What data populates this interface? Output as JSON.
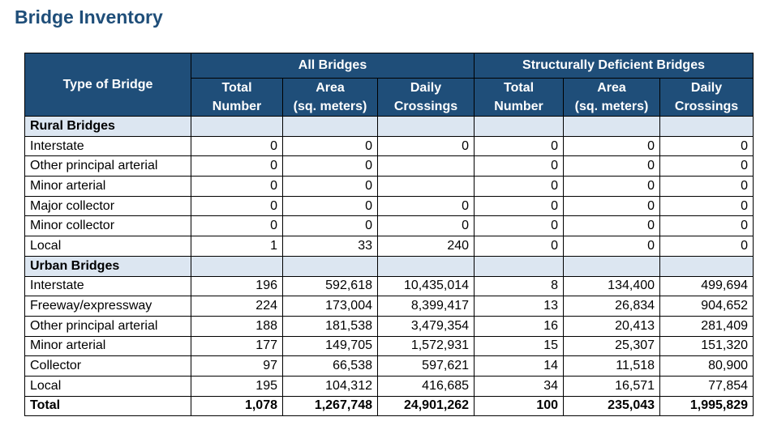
{
  "title": "Bridge Inventory",
  "table": {
    "type_header": "Type of Bridge",
    "group_headers": [
      "All Bridges",
      "Structurally Deficient Bridges"
    ],
    "col_headers": [
      [
        "Total",
        "Number"
      ],
      [
        "Area",
        "(sq. meters)"
      ],
      [
        "Daily",
        "Crossings"
      ],
      [
        "Total",
        "Number"
      ],
      [
        "Area",
        "(sq. meters)"
      ],
      [
        "Daily",
        "Crossings"
      ]
    ],
    "rows": [
      {
        "kind": "section",
        "label": "Rural Bridges",
        "values": [
          "",
          "",
          "",
          "",
          "",
          ""
        ]
      },
      {
        "kind": "data",
        "label": "Interstate",
        "values": [
          "0",
          "0",
          "0",
          "0",
          "0",
          "0"
        ]
      },
      {
        "kind": "data",
        "label": "Other principal arterial",
        "values": [
          "0",
          "0",
          "",
          "0",
          "0",
          "0"
        ]
      },
      {
        "kind": "data",
        "label": "Minor arterial",
        "values": [
          "0",
          "0",
          "",
          "0",
          "0",
          "0"
        ]
      },
      {
        "kind": "data",
        "label": "Major collector",
        "values": [
          "0",
          "0",
          "0",
          "0",
          "0",
          "0"
        ]
      },
      {
        "kind": "data",
        "label": "Minor collector",
        "values": [
          "0",
          "0",
          "0",
          "0",
          "0",
          "0"
        ]
      },
      {
        "kind": "data",
        "label": "Local",
        "values": [
          "1",
          "33",
          "240",
          "0",
          "0",
          "0"
        ]
      },
      {
        "kind": "section",
        "label": "Urban Bridges",
        "values": [
          "",
          "",
          "",
          "",
          "",
          ""
        ]
      },
      {
        "kind": "data",
        "label": "Interstate",
        "values": [
          "196",
          "592,618",
          "10,435,014",
          "8",
          "134,400",
          "499,694"
        ]
      },
      {
        "kind": "data",
        "label": "Freeway/expressway",
        "values": [
          "224",
          "173,004",
          "8,399,417",
          "13",
          "26,834",
          "904,652"
        ]
      },
      {
        "kind": "data",
        "label": "Other principal arterial",
        "values": [
          "188",
          "181,538",
          "3,479,354",
          "16",
          "20,413",
          "281,409"
        ]
      },
      {
        "kind": "data",
        "label": "Minor arterial",
        "values": [
          "177",
          "149,705",
          "1,572,931",
          "15",
          "25,307",
          "151,320"
        ]
      },
      {
        "kind": "data",
        "label": "Collector",
        "values": [
          "97",
          "66,538",
          "597,621",
          "14",
          "11,518",
          "80,900"
        ]
      },
      {
        "kind": "data",
        "label": "Local",
        "values": [
          "195",
          "104,312",
          "416,685",
          "34",
          "16,571",
          "77,854"
        ]
      },
      {
        "kind": "total",
        "label": "Total",
        "values": [
          "1,078",
          "1,267,748",
          "24,901,262",
          "100",
          "235,043",
          "1,995,829"
        ]
      }
    ]
  }
}
